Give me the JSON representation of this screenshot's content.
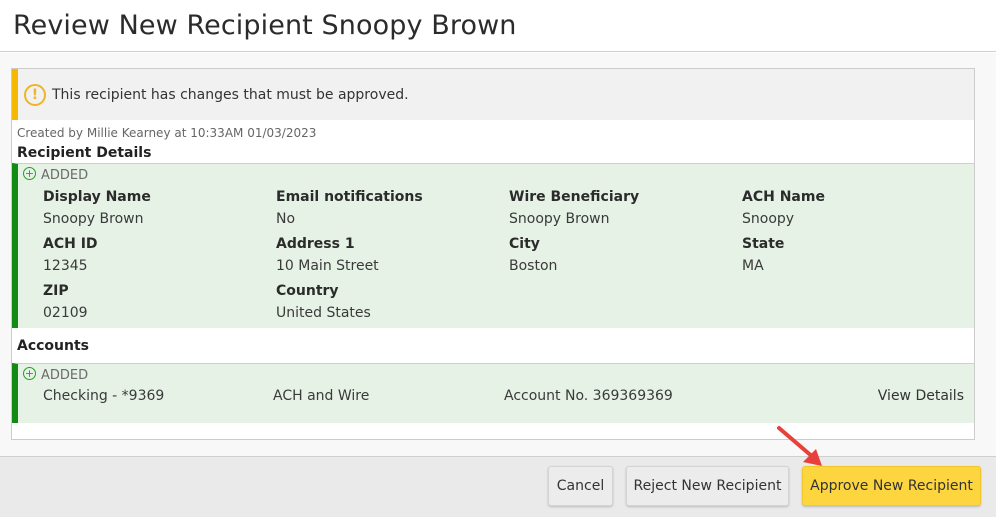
{
  "header": {
    "title": "Review New Recipient Snoopy Brown"
  },
  "alert": {
    "icon": "warning-icon",
    "text": "This recipient has changes that must be approved."
  },
  "meta": {
    "created_text": "Created by Millie Kearney at 10:33AM 01/03/2023"
  },
  "recipient_details": {
    "title": "Recipient Details",
    "status": "ADDED",
    "status_icon": "plus-circle-icon",
    "fields": [
      {
        "label": "Display Name",
        "value": "Snoopy Brown"
      },
      {
        "label": "Email notifications",
        "value": "No"
      },
      {
        "label": "Wire Beneficiary",
        "value": "Snoopy Brown"
      },
      {
        "label": "ACH Name",
        "value": "Snoopy"
      },
      {
        "label": "ACH ID",
        "value": "12345"
      },
      {
        "label": "Address 1",
        "value": "10 Main Street"
      },
      {
        "label": "City",
        "value": "Boston"
      },
      {
        "label": "State",
        "value": "MA"
      },
      {
        "label": "ZIP",
        "value": "02109"
      },
      {
        "label": "Country",
        "value": "United States"
      }
    ]
  },
  "accounts": {
    "title": "Accounts",
    "items": [
      {
        "status": "ADDED",
        "status_icon": "plus-circle-icon",
        "account": "Checking - *9369",
        "type": "ACH and Wire",
        "account_no": "Account No. 369369369",
        "link_label": "View Details"
      }
    ]
  },
  "footer": {
    "cancel_label": "Cancel",
    "reject_label": "Reject New Recipient",
    "approve_label": "Approve New Recipient"
  },
  "colors": {
    "alert_accent": "#f5b800",
    "added_accent": "#138a13",
    "added_bg": "#e5f2e5",
    "approve_button": "#fdd53e",
    "annotation_arrow": "#e8403a"
  }
}
